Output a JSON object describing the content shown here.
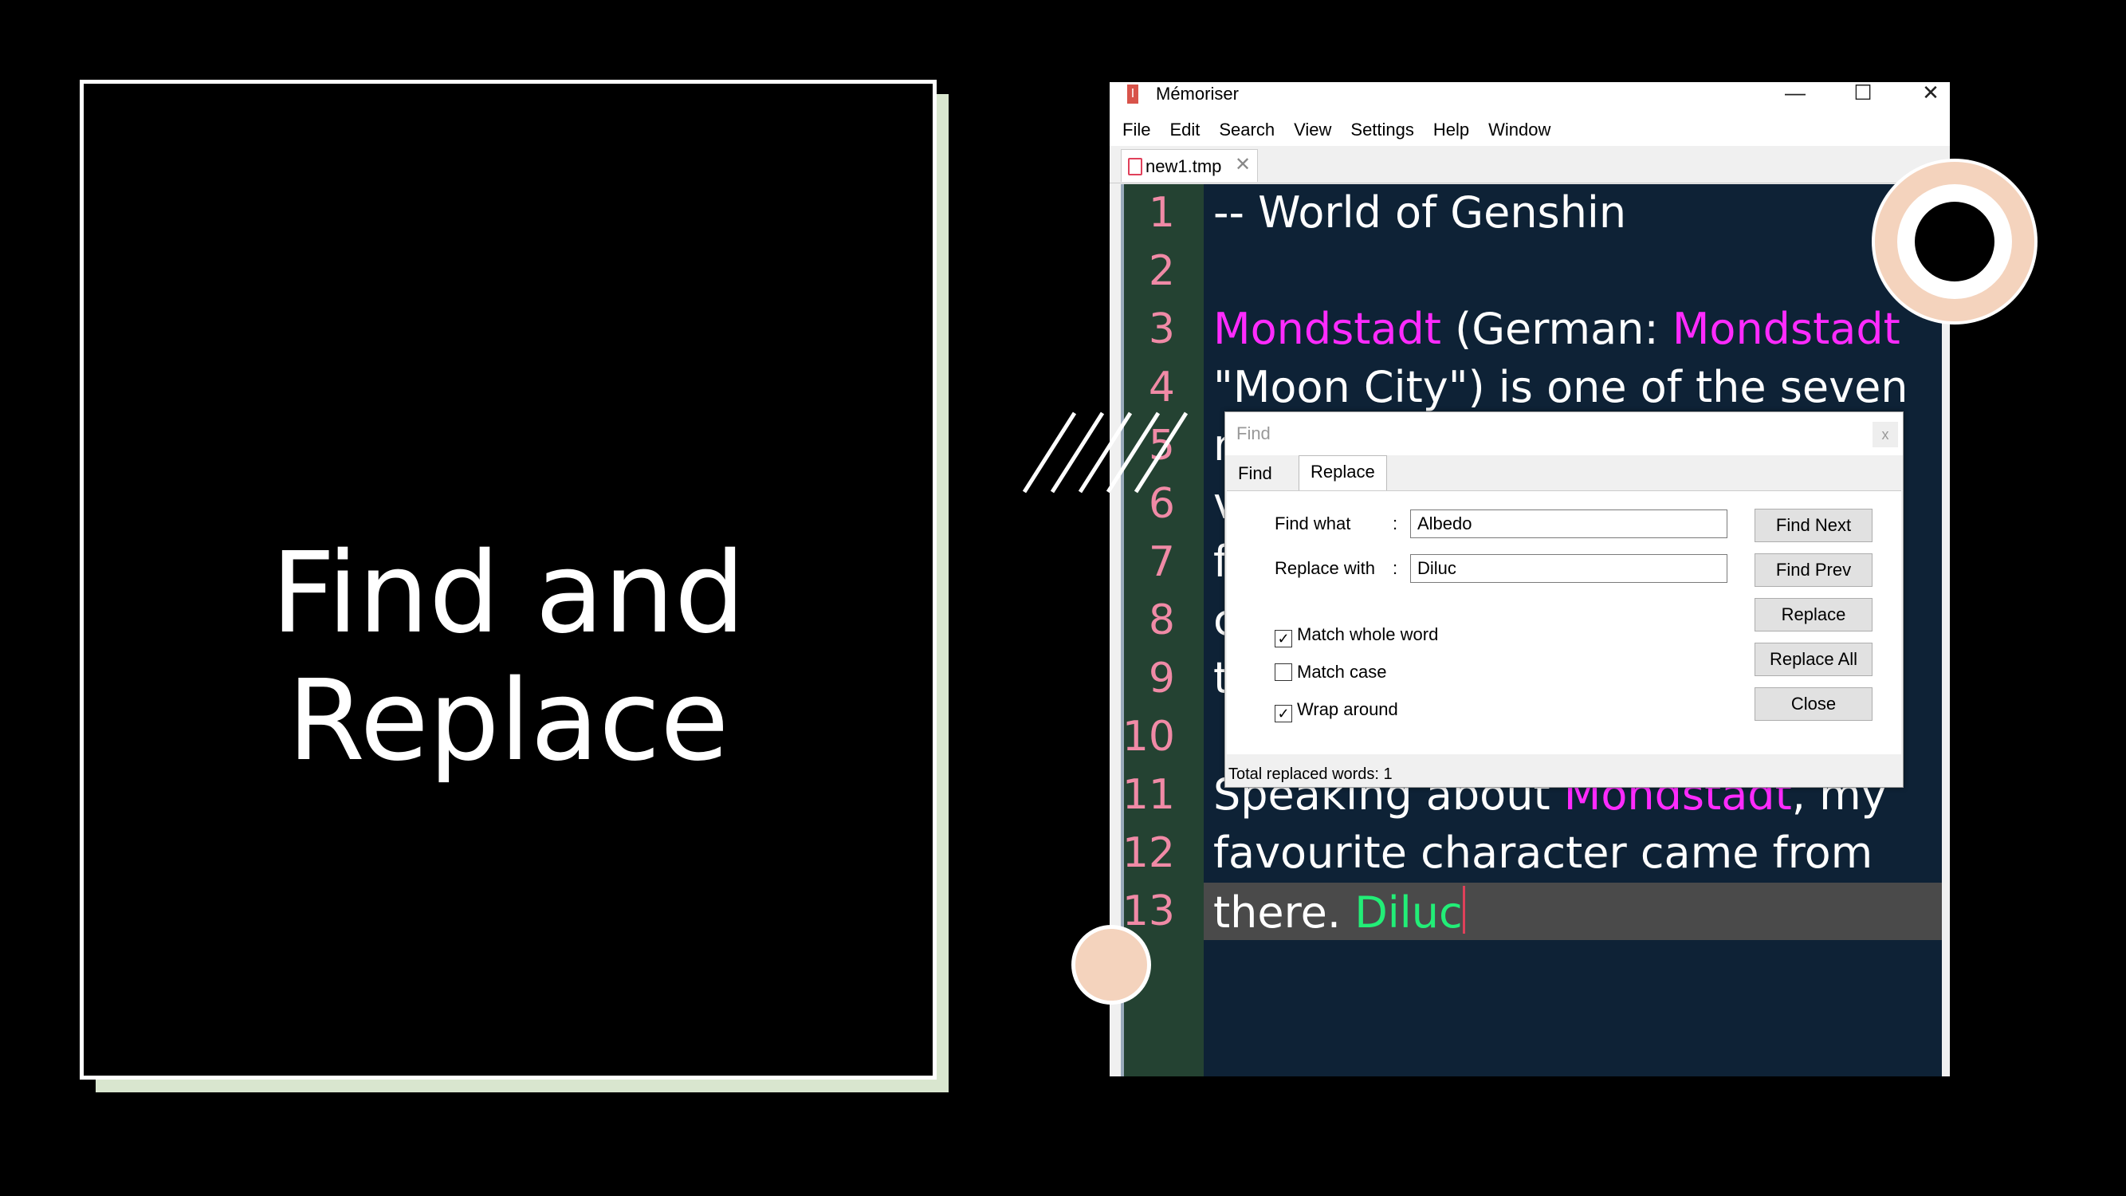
{
  "slide": {
    "title_line1": "Find and",
    "title_line2": "Replace"
  },
  "window": {
    "app_icon": "I",
    "title": "Mémoriser",
    "controls": [
      "—",
      "☐",
      "✕"
    ]
  },
  "menu": [
    "File",
    "Edit",
    "Search",
    "View",
    "Settings",
    "Help",
    "Window"
  ],
  "file_tab": {
    "name": "new1.tmp",
    "close": "✕"
  },
  "editor": {
    "line_numbers": [
      "1",
      "2",
      "3",
      "4",
      "5",
      "6",
      "7",
      "8",
      "9",
      "10",
      "11",
      "12",
      "13"
    ],
    "lines": {
      "l1": "-- World of Genshin",
      "l3a": "Mondstadt",
      "l3b": " (German: ",
      "l3c": "Mondstadt",
      "l4": "\"Moon City\") is  one of the seven",
      "l5": "n",
      "l6": "v",
      "l7": "f",
      "l8": "c",
      "l9": "t",
      "l11a": "Speaking about ",
      "l11b": "Mondstadt",
      "l11c": ", my",
      "l12": "favourite character came from",
      "l13a": "there. ",
      "l13b": "Diluc"
    }
  },
  "find_dialog": {
    "title": "Find",
    "close": "x",
    "tabs": [
      "Find",
      "Replace"
    ],
    "active_tab": "Replace",
    "find_what_label": "Find what",
    "replace_with_label": "Replace with",
    "colon": ":",
    "find_what_value": "Albedo",
    "replace_with_value": "Diluc",
    "options": [
      {
        "label": "Match whole word",
        "checked": true
      },
      {
        "label": "Match case",
        "checked": false
      },
      {
        "label": "Wrap around",
        "checked": true
      }
    ],
    "buttons": [
      "Find Next",
      "Find Prev",
      "Replace",
      "Replace All",
      "Close"
    ],
    "status": "Total replaced words: 1"
  },
  "colors": {
    "keyword": "#ff2bff",
    "replaced": "#22ee77",
    "line_number": "#f08aa6",
    "editor_bg": "#0e2236",
    "gutter_bg": "#244232",
    "accent_peach": "#f4d3bd"
  }
}
